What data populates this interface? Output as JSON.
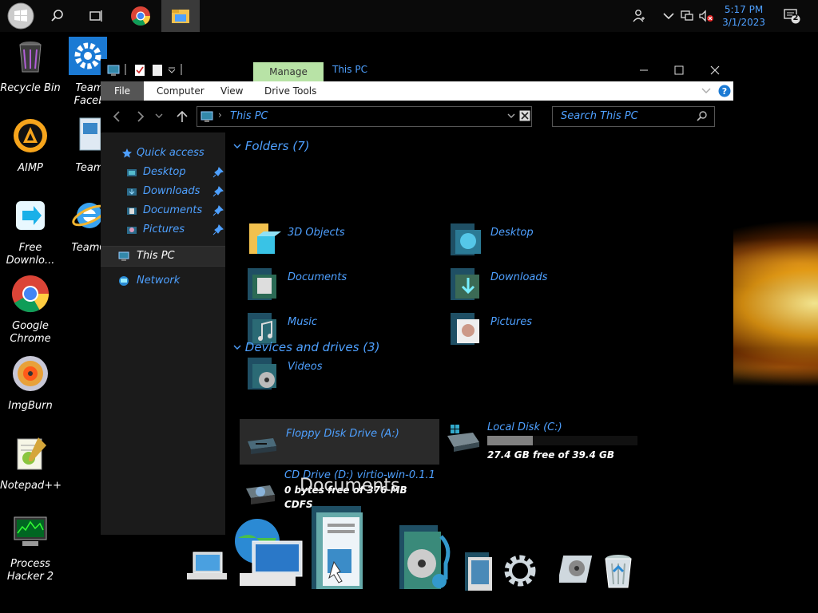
{
  "taskbar": {
    "clock_time": "5:17 PM",
    "clock_date": "3/1/2023",
    "notification_count": "2"
  },
  "desktop": {
    "icons": [
      {
        "label": "Recycle Bin"
      },
      {
        "label": "AIMP"
      },
      {
        "label": "Free Downlo..."
      },
      {
        "label": "Google Chrome"
      },
      {
        "label": "ImgBurn"
      },
      {
        "label": "Notepad++"
      },
      {
        "label": "Process Hacker 2"
      },
      {
        "label": "Team Faceb"
      },
      {
        "label": "Team"
      },
      {
        "label": "TeamO"
      }
    ]
  },
  "window": {
    "context_tab": "Manage",
    "title": "This PC",
    "ribbon_tabs": [
      "File",
      "Computer",
      "View",
      "Drive Tools"
    ],
    "address": "This PC",
    "search_placeholder": "Search This PC",
    "nav": {
      "quick_access": "Quick access",
      "items": [
        "Desktop",
        "Downloads",
        "Documents",
        "Pictures"
      ],
      "this_pc": "This PC",
      "network": "Network"
    },
    "folders_header": "Folders (7)",
    "folders": [
      "3D Objects",
      "Desktop",
      "Documents",
      "Downloads",
      "Music",
      "Pictures",
      "Videos"
    ],
    "devices_header": "Devices and drives (3)",
    "drives": {
      "floppy": {
        "label": "Floppy Disk Drive (A:)"
      },
      "local": {
        "label": "Local Disk (C:)",
        "free": "27.4 GB free of 39.4 GB",
        "used_fraction": 0.305
      },
      "cd": {
        "label": "CD Drive (D:) virtio-win-0.1.1",
        "free": "0 bytes free of 376 MB",
        "fs": "CDFS"
      }
    }
  },
  "dock": {
    "label": "Documents",
    "items": [
      "network-icon",
      "computer-icon",
      "documents-icon",
      "music-icon",
      "pictures-icon",
      "settings-icon",
      "drive-icon",
      "recycle-bin-icon"
    ]
  },
  "colors": {
    "accent": "#4ea0ff",
    "manage_tab": "#b8e3a6"
  }
}
